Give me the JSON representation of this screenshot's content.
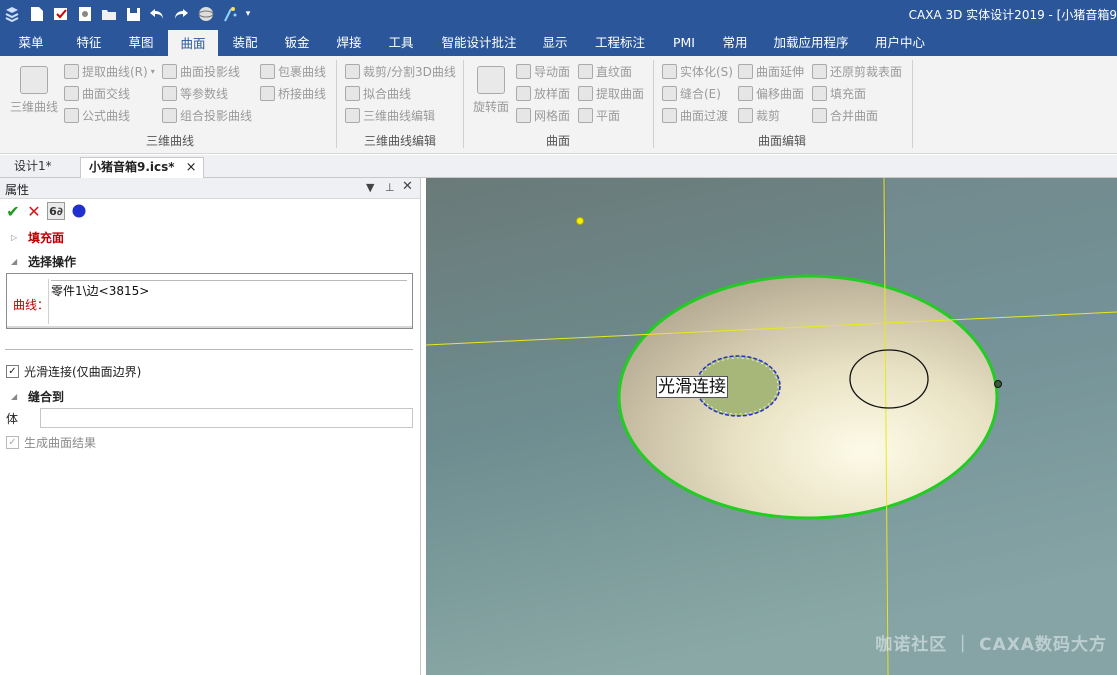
{
  "titlebar": {
    "title": "CAXA 3D 实体设计2019 - [小猪音箱9",
    "quick_access_icons": [
      "app-menu-icon",
      "new-file-icon",
      "open-icon",
      "print-icon",
      "open-folder-icon",
      "save-icon",
      "undo-icon",
      "redo-icon",
      "sphere-icon",
      "wizard-icon",
      "dropdown-icon"
    ]
  },
  "menubar": {
    "tabs": [
      {
        "label": "菜单"
      },
      {
        "label": "特征"
      },
      {
        "label": "草图"
      },
      {
        "label": "曲面"
      },
      {
        "label": "装配"
      },
      {
        "label": "钣金"
      },
      {
        "label": "焊接"
      },
      {
        "label": "工具"
      },
      {
        "label": "智能设计批注"
      },
      {
        "label": "显示"
      },
      {
        "label": "工程标注"
      },
      {
        "label": "PMI"
      },
      {
        "label": "常用"
      },
      {
        "label": "加载应用程序"
      },
      {
        "label": "用户中心"
      }
    ],
    "active_tab": "曲面"
  },
  "ribbon": {
    "groups": [
      {
        "label": "三维曲线",
        "big_button": "三维曲线",
        "items": [
          "提取曲线(R)",
          "曲面交线",
          "公式曲线",
          "曲面投影线",
          "等参数线",
          "组合投影曲线",
          "包裹曲线",
          "桥接曲线"
        ]
      },
      {
        "label": "三维曲线编辑",
        "items": [
          "裁剪/分割3D曲线",
          "拟合曲线",
          "三维曲线编辑"
        ]
      },
      {
        "label": "曲面",
        "big_button": "旋转面",
        "items": [
          "导动面",
          "放样面",
          "网格面",
          "直纹面",
          "提取曲面",
          "平面"
        ]
      },
      {
        "label": "曲面编辑",
        "items": [
          "实体化(S)",
          "缝合(E)",
          "曲面过渡",
          "曲面延伸",
          "偏移曲面",
          "裁剪",
          "还原剪裁表面",
          "填充面",
          "合并曲面"
        ]
      }
    ]
  },
  "doc_tabs": [
    {
      "label": "设计1*"
    },
    {
      "label": "小猪音箱9.ics*"
    }
  ],
  "panel": {
    "title": "属性",
    "section_fill": "填充面",
    "section_select": "选择操作",
    "curve_label": "曲线：",
    "curve_value": "零件1\\边<3815>",
    "smooth_checkbox": "光滑连接(仅曲面边界)",
    "smooth_checked": true,
    "section_stitch": "缝合到",
    "body_label": "体",
    "body_value": "",
    "generate_checkbox": "生成曲面结果",
    "generate_checked": true,
    "generate_enabled": false
  },
  "viewport": {
    "annotation": "光滑连接",
    "watermark": "咖诺社区 ｜ CAXA数码大方",
    "colors": {
      "background": "#6f8a8c",
      "boundary": "#22cc22",
      "axis": "#e8e820",
      "highlight_edge": "#2233cc"
    }
  }
}
